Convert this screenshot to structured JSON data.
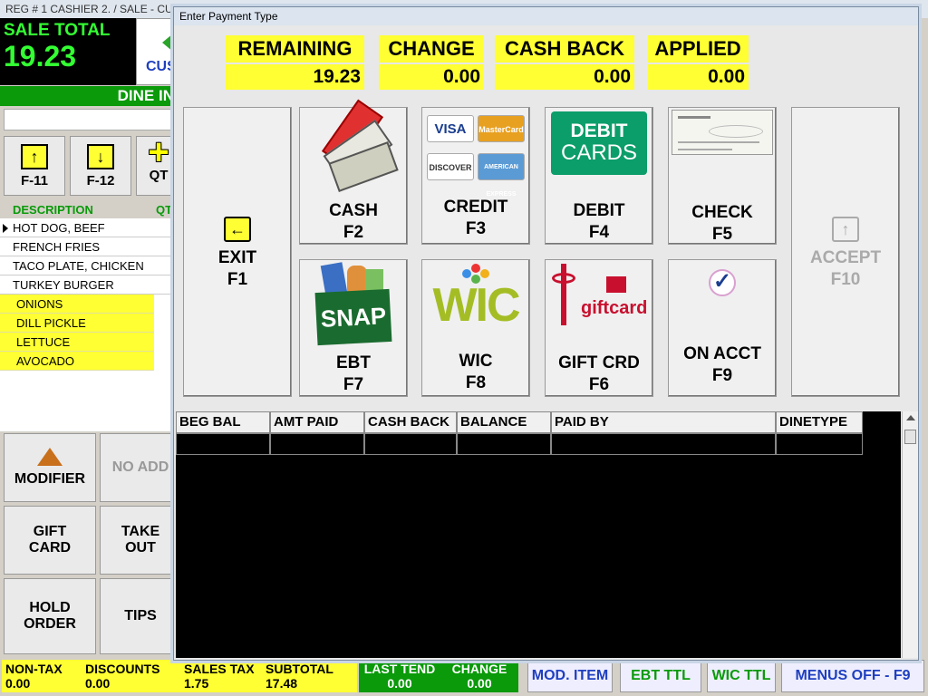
{
  "background": {
    "titlebar": "REG # 1  CASHIER 2. /  SALE - CUST",
    "sale_total_label": "SALE TOTAL",
    "sale_total_value": "19.23",
    "cust_partial": "CUS",
    "dine_in_partial": "DINE IN",
    "fkeys": [
      {
        "label": "F-11",
        "icon": "arrow-up-icon"
      },
      {
        "label": "F-12",
        "icon": "arrow-down-icon"
      },
      {
        "label": "QT",
        "icon": "plus-icon"
      }
    ],
    "columns": {
      "description": "DESCRIPTION",
      "qty_partial": "QT"
    },
    "items": [
      {
        "name": "HOT DOG, BEEF",
        "modifier": false,
        "selected": true
      },
      {
        "name": "FRENCH FRIES",
        "modifier": false
      },
      {
        "name": "TACO PLATE, CHICKEN",
        "modifier": false
      },
      {
        "name": "TURKEY BURGER",
        "modifier": false
      },
      {
        "name": "ONIONS",
        "modifier": true
      },
      {
        "name": "DILL PICKLE",
        "modifier": true
      },
      {
        "name": "LETTUCE",
        "modifier": true
      },
      {
        "name": "AVOCADO",
        "modifier": true
      }
    ],
    "buttons": {
      "modifier": "MODIFIER",
      "no_add_partial": "NO ADD",
      "gift_card_1": "GIFT",
      "gift_card_2": "CARD",
      "take_out_1": "TAKE",
      "take_out_2": "OUT",
      "hold_order_1": "HOLD",
      "hold_order_2": "ORDER",
      "tips": "TIPS"
    },
    "status": {
      "non_tax_label": "NON-TAX",
      "non_tax_value": "0.00",
      "discounts_label": "DISCOUNTS",
      "discounts_value": "0.00",
      "sales_tax_label": "SALES TAX",
      "sales_tax_value": "1.75",
      "subtotal_label": "SUBTOTAL",
      "subtotal_value": "17.48",
      "last_tend_label": "LAST TEND",
      "last_tend_value": "0.00",
      "change_label": "CHANGE",
      "change_value": "0.00"
    },
    "bottom_buttons": {
      "mod_item": "MOD. ITEM",
      "ebt_ttl": "EBT TTL",
      "wic_ttl": "WIC TTL",
      "menus_off": "MENUS OFF - F9"
    }
  },
  "dialog": {
    "title": "Enter Payment Type",
    "totals": [
      {
        "label": "REMAINING",
        "value": "19.23"
      },
      {
        "label": "CHANGE",
        "value": "0.00"
      },
      {
        "label": "CASH BACK",
        "value": "0.00"
      },
      {
        "label": "APPLIED",
        "value": "0.00"
      }
    ],
    "buttons": {
      "exit": {
        "label": "EXIT",
        "key": "F1",
        "icon": "arrow-left-icon"
      },
      "cash": {
        "label": "CASH",
        "key": "F2",
        "icon": "cash-icon"
      },
      "credit": {
        "label": "CREDIT",
        "key": "F3",
        "icon": "credit-cards-icon"
      },
      "debit": {
        "label": "DEBIT",
        "key": "F4",
        "icon": "debit-cards-icon"
      },
      "check": {
        "label": "CHECK",
        "key": "F5",
        "icon": "check-icon"
      },
      "accept": {
        "label": "ACCEPT",
        "key": "F10",
        "icon": "arrow-up-icon",
        "disabled": true
      },
      "ebt": {
        "label": "EBT",
        "key": "F7",
        "icon": "snap-icon"
      },
      "wic": {
        "label": "WIC",
        "key": "F8",
        "icon": "wic-icon"
      },
      "gift": {
        "label": "GIFT CRD",
        "key": "F6",
        "icon": "giftcard-icon"
      },
      "on_acct": {
        "label": "ON ACCT",
        "key": "F9",
        "icon": "checkmark-icon"
      }
    },
    "logos": {
      "debit_line1": "DEBIT",
      "debit_line2": "CARDS",
      "snap": "SNAP",
      "wic": "WIC",
      "gift": "giftcard",
      "credit_cards": [
        "VISA",
        "MasterCard",
        "DISCOVER",
        "AMERICAN EXPRESS"
      ]
    },
    "table": {
      "columns": [
        "BEG BAL",
        "AMT PAID",
        "CASH BACK",
        "BALANCE",
        "PAID BY",
        "DINETYPE"
      ]
    }
  },
  "colors": {
    "yellow": "#ffff33",
    "green": "#0a9a0a",
    "blue": "#1f3fbf",
    "black": "#000000"
  }
}
